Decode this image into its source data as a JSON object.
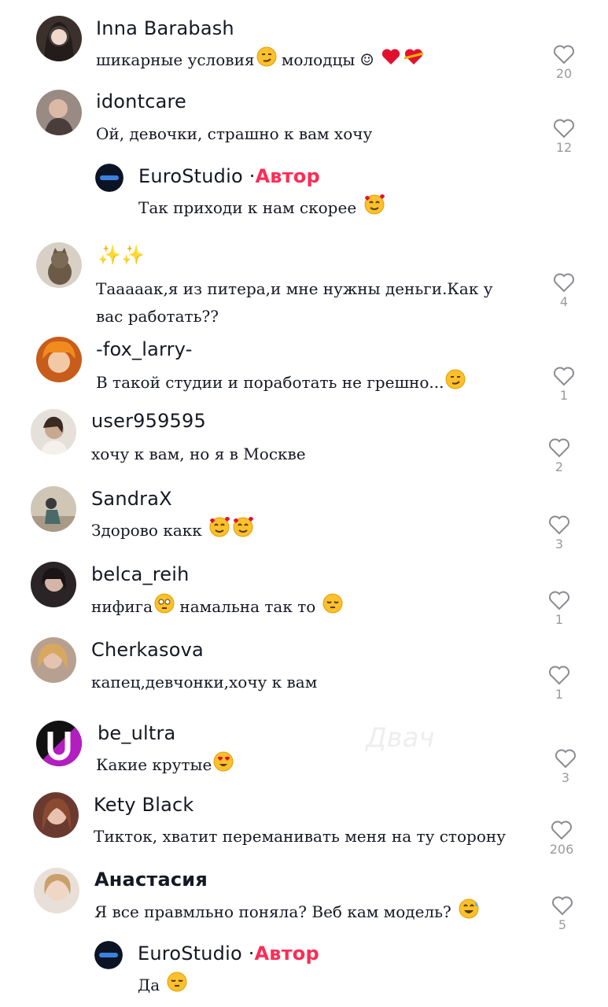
{
  "comments": [
    {
      "username": "Inna Barabash",
      "text": "шикарные условия",
      "text2": "молодцы ☺",
      "likes": "20"
    },
    {
      "username": "idontcare",
      "text": "Ой, девочки, страшно к вам хочу",
      "likes": "12",
      "reply": {
        "username": "EuroStudio",
        "separator": "·",
        "badge": "Автор",
        "text": "Так приходи к нам скорее"
      }
    },
    {
      "username": "✨✨",
      "text": "Тааааак,я из питера,и мне нужны деньги.Как у вас работать??",
      "likes": "4"
    },
    {
      "username": "-fox_larry-",
      "text": "В такой студии и поработать не грешно...",
      "likes": "1"
    },
    {
      "username": "user959595",
      "text": "хочу к вам, но я в Москве",
      "likes": "2"
    },
    {
      "username": "SandraX",
      "text": "Здорово какк",
      "likes": "3"
    },
    {
      "username": "belca_reih",
      "text": "нифига",
      "text2": "намальна так то",
      "likes": "1"
    },
    {
      "username": "Cherkasova",
      "text": "капец,девчонки,хочу к вам",
      "likes": "1"
    },
    {
      "username": "be_ultra",
      "text": "Какие крутые",
      "likes": "3"
    },
    {
      "username": "Kety Black",
      "text": "Тикток, хватит переманивать меня на ту сторону",
      "likes": "206"
    },
    {
      "username": "Анастасия",
      "text": "Я все правмльно поняла? Веб кам модель?",
      "likes": "5",
      "reply": {
        "username": "EuroStudio",
        "separator": "·",
        "badge": "Автор",
        "text": "Да"
      }
    }
  ],
  "watermark": "Двач",
  "colors": {
    "accent": "#fe2c55",
    "text": "#161823",
    "muted": "#9a9aa0"
  }
}
